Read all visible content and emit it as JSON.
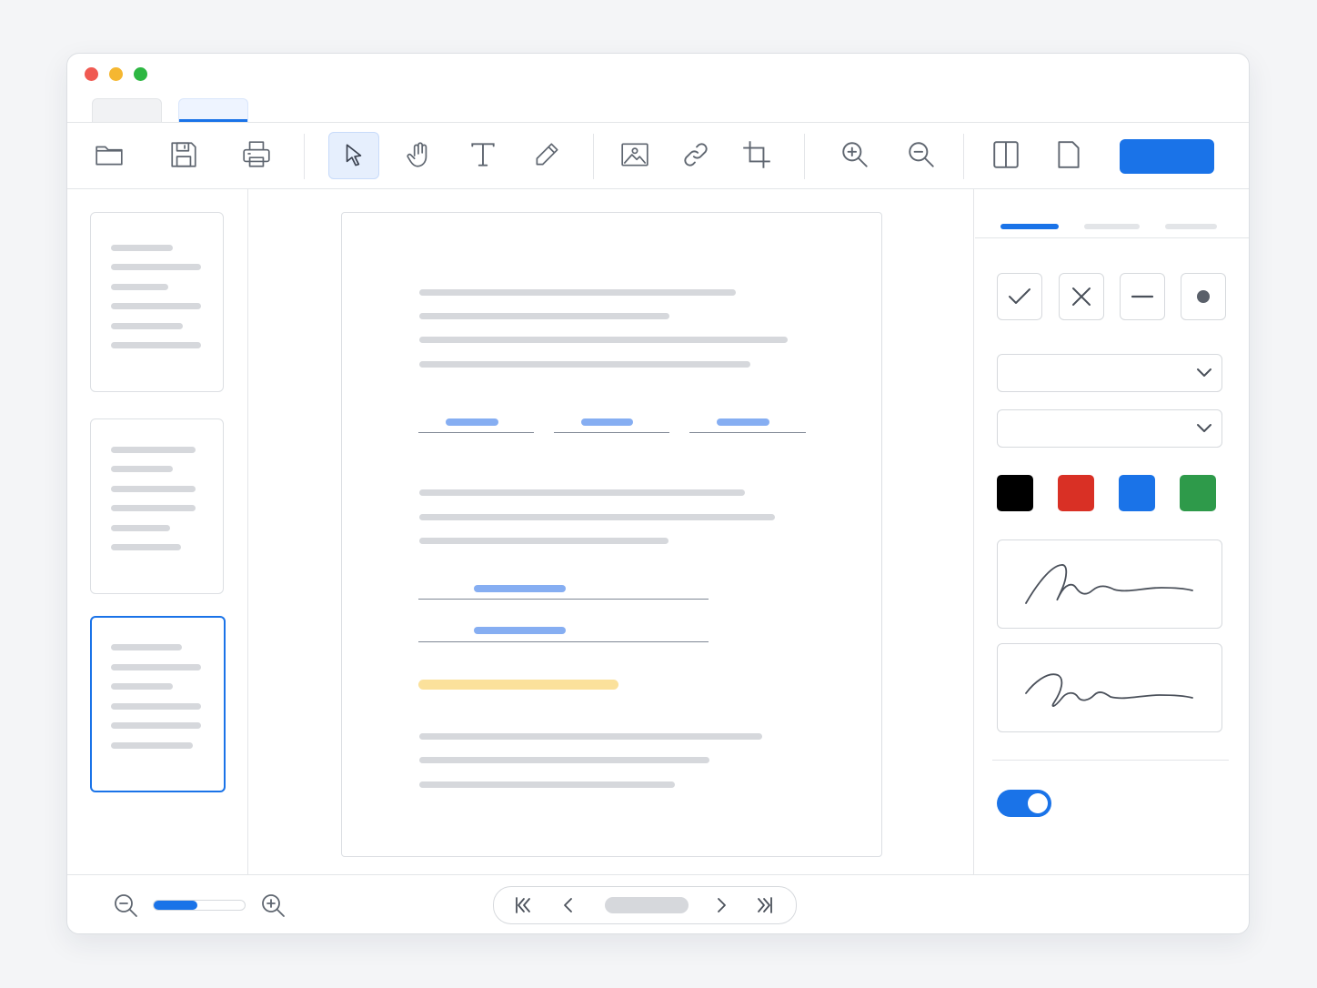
{
  "colors": {
    "accent": "#1a73e8",
    "traffic_close": "#f05a52",
    "traffic_minimize": "#f5b731",
    "traffic_maximize": "#2db742",
    "highlight": "#fbe19b",
    "swatches": [
      "#000000",
      "#d93025",
      "#1a73e8",
      "#2e9a4a"
    ]
  },
  "toolbar": {
    "icons": [
      "folder-icon",
      "save-icon",
      "print-icon",
      "pointer-icon",
      "hand-icon",
      "text-icon",
      "pencil-icon",
      "image-icon",
      "link-icon",
      "crop-icon",
      "zoom-in-icon",
      "zoom-out-icon",
      "split-view-icon",
      "page-icon"
    ],
    "active_tool": "pointer-icon"
  },
  "thumbnails": {
    "count": 3,
    "selected_index": 2
  },
  "panel": {
    "tabs_count": 3,
    "active_tab_index": 0,
    "stamp_icons": [
      "check-icon",
      "cross-icon",
      "dash-icon",
      "dot-icon"
    ],
    "dropdown_icon": "chevron-down-icon",
    "toggle_on": true
  },
  "zoom": {
    "level_fraction": 0.48
  },
  "pager_icons": [
    "first-page-icon",
    "prev-page-icon",
    "next-page-icon",
    "last-page-icon"
  ]
}
